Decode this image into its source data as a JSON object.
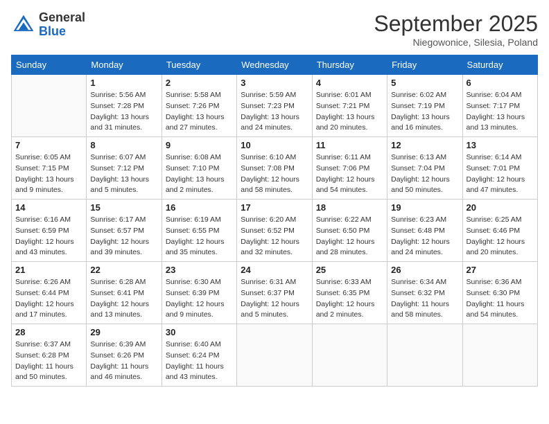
{
  "header": {
    "logo_general": "General",
    "logo_blue": "Blue",
    "month_title": "September 2025",
    "subtitle": "Niegowonice, Silesia, Poland"
  },
  "days_of_week": [
    "Sunday",
    "Monday",
    "Tuesday",
    "Wednesday",
    "Thursday",
    "Friday",
    "Saturday"
  ],
  "weeks": [
    [
      {
        "day": "",
        "sunrise": "",
        "sunset": "",
        "daylight": ""
      },
      {
        "day": "1",
        "sunrise": "Sunrise: 5:56 AM",
        "sunset": "Sunset: 7:28 PM",
        "daylight": "Daylight: 13 hours and 31 minutes."
      },
      {
        "day": "2",
        "sunrise": "Sunrise: 5:58 AM",
        "sunset": "Sunset: 7:26 PM",
        "daylight": "Daylight: 13 hours and 27 minutes."
      },
      {
        "day": "3",
        "sunrise": "Sunrise: 5:59 AM",
        "sunset": "Sunset: 7:23 PM",
        "daylight": "Daylight: 13 hours and 24 minutes."
      },
      {
        "day": "4",
        "sunrise": "Sunrise: 6:01 AM",
        "sunset": "Sunset: 7:21 PM",
        "daylight": "Daylight: 13 hours and 20 minutes."
      },
      {
        "day": "5",
        "sunrise": "Sunrise: 6:02 AM",
        "sunset": "Sunset: 7:19 PM",
        "daylight": "Daylight: 13 hours and 16 minutes."
      },
      {
        "day": "6",
        "sunrise": "Sunrise: 6:04 AM",
        "sunset": "Sunset: 7:17 PM",
        "daylight": "Daylight: 13 hours and 13 minutes."
      }
    ],
    [
      {
        "day": "7",
        "sunrise": "Sunrise: 6:05 AM",
        "sunset": "Sunset: 7:15 PM",
        "daylight": "Daylight: 13 hours and 9 minutes."
      },
      {
        "day": "8",
        "sunrise": "Sunrise: 6:07 AM",
        "sunset": "Sunset: 7:12 PM",
        "daylight": "Daylight: 13 hours and 5 minutes."
      },
      {
        "day": "9",
        "sunrise": "Sunrise: 6:08 AM",
        "sunset": "Sunset: 7:10 PM",
        "daylight": "Daylight: 13 hours and 2 minutes."
      },
      {
        "day": "10",
        "sunrise": "Sunrise: 6:10 AM",
        "sunset": "Sunset: 7:08 PM",
        "daylight": "Daylight: 12 hours and 58 minutes."
      },
      {
        "day": "11",
        "sunrise": "Sunrise: 6:11 AM",
        "sunset": "Sunset: 7:06 PM",
        "daylight": "Daylight: 12 hours and 54 minutes."
      },
      {
        "day": "12",
        "sunrise": "Sunrise: 6:13 AM",
        "sunset": "Sunset: 7:04 PM",
        "daylight": "Daylight: 12 hours and 50 minutes."
      },
      {
        "day": "13",
        "sunrise": "Sunrise: 6:14 AM",
        "sunset": "Sunset: 7:01 PM",
        "daylight": "Daylight: 12 hours and 47 minutes."
      }
    ],
    [
      {
        "day": "14",
        "sunrise": "Sunrise: 6:16 AM",
        "sunset": "Sunset: 6:59 PM",
        "daylight": "Daylight: 12 hours and 43 minutes."
      },
      {
        "day": "15",
        "sunrise": "Sunrise: 6:17 AM",
        "sunset": "Sunset: 6:57 PM",
        "daylight": "Daylight: 12 hours and 39 minutes."
      },
      {
        "day": "16",
        "sunrise": "Sunrise: 6:19 AM",
        "sunset": "Sunset: 6:55 PM",
        "daylight": "Daylight: 12 hours and 35 minutes."
      },
      {
        "day": "17",
        "sunrise": "Sunrise: 6:20 AM",
        "sunset": "Sunset: 6:52 PM",
        "daylight": "Daylight: 12 hours and 32 minutes."
      },
      {
        "day": "18",
        "sunrise": "Sunrise: 6:22 AM",
        "sunset": "Sunset: 6:50 PM",
        "daylight": "Daylight: 12 hours and 28 minutes."
      },
      {
        "day": "19",
        "sunrise": "Sunrise: 6:23 AM",
        "sunset": "Sunset: 6:48 PM",
        "daylight": "Daylight: 12 hours and 24 minutes."
      },
      {
        "day": "20",
        "sunrise": "Sunrise: 6:25 AM",
        "sunset": "Sunset: 6:46 PM",
        "daylight": "Daylight: 12 hours and 20 minutes."
      }
    ],
    [
      {
        "day": "21",
        "sunrise": "Sunrise: 6:26 AM",
        "sunset": "Sunset: 6:44 PM",
        "daylight": "Daylight: 12 hours and 17 minutes."
      },
      {
        "day": "22",
        "sunrise": "Sunrise: 6:28 AM",
        "sunset": "Sunset: 6:41 PM",
        "daylight": "Daylight: 12 hours and 13 minutes."
      },
      {
        "day": "23",
        "sunrise": "Sunrise: 6:30 AM",
        "sunset": "Sunset: 6:39 PM",
        "daylight": "Daylight: 12 hours and 9 minutes."
      },
      {
        "day": "24",
        "sunrise": "Sunrise: 6:31 AM",
        "sunset": "Sunset: 6:37 PM",
        "daylight": "Daylight: 12 hours and 5 minutes."
      },
      {
        "day": "25",
        "sunrise": "Sunrise: 6:33 AM",
        "sunset": "Sunset: 6:35 PM",
        "daylight": "Daylight: 12 hours and 2 minutes."
      },
      {
        "day": "26",
        "sunrise": "Sunrise: 6:34 AM",
        "sunset": "Sunset: 6:32 PM",
        "daylight": "Daylight: 11 hours and 58 minutes."
      },
      {
        "day": "27",
        "sunrise": "Sunrise: 6:36 AM",
        "sunset": "Sunset: 6:30 PM",
        "daylight": "Daylight: 11 hours and 54 minutes."
      }
    ],
    [
      {
        "day": "28",
        "sunrise": "Sunrise: 6:37 AM",
        "sunset": "Sunset: 6:28 PM",
        "daylight": "Daylight: 11 hours and 50 minutes."
      },
      {
        "day": "29",
        "sunrise": "Sunrise: 6:39 AM",
        "sunset": "Sunset: 6:26 PM",
        "daylight": "Daylight: 11 hours and 46 minutes."
      },
      {
        "day": "30",
        "sunrise": "Sunrise: 6:40 AM",
        "sunset": "Sunset: 6:24 PM",
        "daylight": "Daylight: 11 hours and 43 minutes."
      },
      {
        "day": "",
        "sunrise": "",
        "sunset": "",
        "daylight": ""
      },
      {
        "day": "",
        "sunrise": "",
        "sunset": "",
        "daylight": ""
      },
      {
        "day": "",
        "sunrise": "",
        "sunset": "",
        "daylight": ""
      },
      {
        "day": "",
        "sunrise": "",
        "sunset": "",
        "daylight": ""
      }
    ]
  ]
}
